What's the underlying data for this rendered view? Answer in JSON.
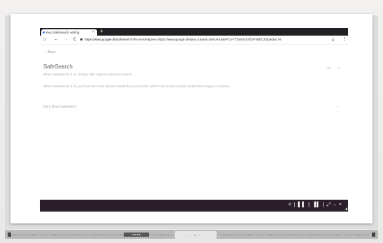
{
  "browser": {
    "tab_title": "Your SafeSearch setting",
    "new_tab": "+",
    "url_host": "https://www.google.dk",
    "url_path": "/safesearch?hl=en-DK&prev=https://www.google.dk/&sa=X&ved=0ahUKEwi8PCu-T7ZWUcS7tDHYBbCZ4QkqlvCAs",
    "nav_back": "←",
    "nav_forward": "→",
    "nav_reload": "C",
    "home": "⌂",
    "download": "⤓",
    "menu": "⋮"
  },
  "page": {
    "back_label": "← Back",
    "title": "SafeSearch",
    "desc_on": "When SafeSearch is on, it helps hide explicit content on Search.",
    "desc_off": "When SafeSearch is off, you'll see the most relevant results for your search, which may include explicit content like images of violence.",
    "toggle_off": "off",
    "toggle_on": "on",
    "more_label": "More about SafeSearch",
    "more_chevron": "⌄"
  },
  "system_bar": {
    "icons": "< | ▌▌ | ▐▌ | ⤢ – ×",
    "corner": "◢"
  },
  "tray": {
    "label": "■ ■ ■ ■",
    "center": "◦ ◦ ◦  ► ◦ ◦ ◦"
  }
}
